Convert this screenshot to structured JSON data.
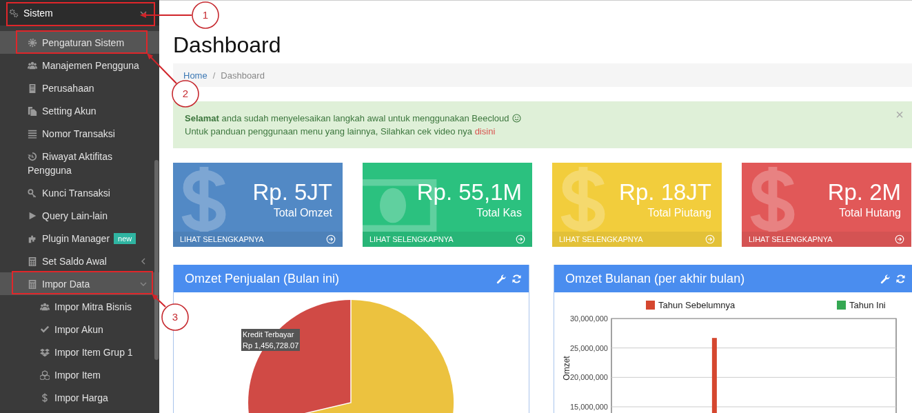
{
  "sidebar": {
    "section": {
      "label": "Sistem",
      "expanded": true
    },
    "items": [
      {
        "label": "Pengaturan Sistem",
        "selected": true
      },
      {
        "label": "Manajemen Pengguna",
        "selected": false
      },
      {
        "label": "Perusahaan",
        "selected": false
      },
      {
        "label": "Setting Akun",
        "selected": false
      },
      {
        "label": "Nomor Transaksi",
        "selected": false
      },
      {
        "label": "Riwayat Aktifitas Pengguna",
        "selected": false
      },
      {
        "label": "Kunci Transaksi",
        "selected": false
      },
      {
        "label": "Query Lain-lain",
        "selected": false
      },
      {
        "label": "Plugin Manager",
        "selected": false,
        "badge": "new"
      },
      {
        "label": "Set Saldo Awal",
        "selected": false,
        "expanded": false
      },
      {
        "label": "Impor Data",
        "selected": true,
        "expanded": true,
        "children": [
          {
            "label": "Impor Mitra Bisnis",
            "selected": false
          },
          {
            "label": "Impor Akun",
            "selected": false
          },
          {
            "label": "Impor Item Grup 1",
            "selected": false
          },
          {
            "label": "Impor Item",
            "selected": false
          },
          {
            "label": "Impor Harga",
            "selected": false
          }
        ]
      }
    ]
  },
  "page": {
    "title": "Dashboard",
    "breadcrumb": {
      "separator": "/",
      "items": [
        {
          "label": "Home",
          "current": false
        },
        {
          "label": "Dashboard",
          "current": true
        }
      ]
    },
    "alert": {
      "lead": "**Selamat** anda sudah menyelesaikan langkah awal untuk menggunakan Beecloud",
      "text": "Untuk panduan penggunaan menu yang lainnya, Silahkan cek video nya",
      "link": "disini",
      "close": "×"
    },
    "stat_cards": [
      {
        "value": "Rp. 5JT",
        "label": "Total Omzet",
        "link": "LIHAT SELENGKAPNYA",
        "color": "#5289c5",
        "kind": "dollar"
      },
      {
        "value": "Rp. 55,1M",
        "label": "Total Kas",
        "link": "LIHAT SELENGKAPNYA",
        "color": "#2bc17f",
        "kind": "banknote"
      },
      {
        "value": "Rp. 18JT",
        "label": "Total Piutang",
        "link": "LIHAT SELENGKAPNYA",
        "color": "#f2cd3c",
        "kind": "dollar"
      },
      {
        "value": "Rp. 2M",
        "label": "Total Hutang",
        "link": "LIHAT SELENGKAPNYA",
        "color": "#e15858",
        "kind": "dollar"
      }
    ],
    "panels": [
      {
        "title": "Omzet Penjualan (Bulan ini)",
        "kind": "pie",
        "tooltip": {
          "title": "Kredit Terbayar",
          "value": "Rp 1,456,728.07"
        }
      },
      {
        "title": "Omzet Bulanan (per akhir bulan)",
        "kind": "bar",
        "chart_data": {
          "type": "bar",
          "ylabel": "Omzet",
          "ylim": [
            0,
            30000000
          ],
          "grid": true,
          "yticks": [
            {
              "value": 15000000,
              "label": "15,000,000"
            },
            {
              "value": 20000000,
              "label": "20,000,000"
            },
            {
              "value": 25000000,
              "label": "25,000,000"
            },
            {
              "value": 30000000,
              "label": "30,000,000"
            }
          ],
          "series": [
            {
              "name": "Tahun Sebelumnya",
              "color": "#d5472f",
              "values": [
                0,
                0,
                0,
                0,
                26700000,
                0,
                0,
                0,
                0,
                0,
                0,
                0
              ]
            },
            {
              "name": "Tahun Ini",
              "color": "#35a853",
              "values": [
                0,
                0,
                0,
                0,
                0,
                0,
                0,
                0,
                0,
                0,
                0,
                0
              ]
            }
          ]
        }
      }
    ]
  },
  "annotations": [
    {
      "number": "1"
    },
    {
      "number": "2"
    },
    {
      "number": "3"
    }
  ]
}
